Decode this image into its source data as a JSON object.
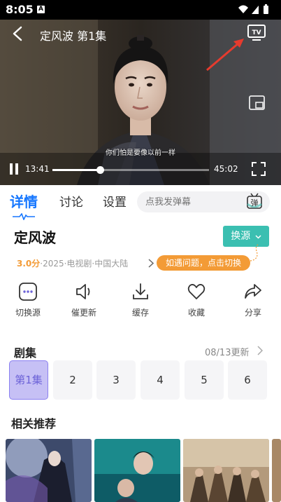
{
  "status_bar": {
    "time": "8:05",
    "notification_letter": "A"
  },
  "player": {
    "title": "定风波 第1集",
    "subtitle": "你们怕是要像以前一样",
    "current_time": "13:41",
    "total_time": "45:02",
    "progress": 0.304
  },
  "tabs": [
    {
      "label": "详情",
      "active": true
    },
    {
      "label": "讨论",
      "active": false
    },
    {
      "label": "设置",
      "active": false
    }
  ],
  "danmaku": {
    "placeholder": "点我发弹幕",
    "button_label": "弹"
  },
  "show": {
    "title": "定风波",
    "rating": "3.0分",
    "meta": "·2025·电视剧·中国大陆",
    "switch_source_label": "换源",
    "hint": "如遇问题，点击切换"
  },
  "actions": [
    {
      "label": "切换源",
      "icon": "source-icon"
    },
    {
      "label": "催更新",
      "icon": "megaphone-icon"
    },
    {
      "label": "缓存",
      "icon": "download-icon"
    },
    {
      "label": "收藏",
      "icon": "heart-icon"
    },
    {
      "label": "分享",
      "icon": "share-icon"
    }
  ],
  "episodes": {
    "title": "剧集",
    "update_text": "08/13更新",
    "items": [
      {
        "label": "第1集",
        "active": true
      },
      {
        "label": "2",
        "active": false
      },
      {
        "label": "3",
        "active": false
      },
      {
        "label": "4",
        "active": false
      },
      {
        "label": "5",
        "active": false
      },
      {
        "label": "6",
        "active": false
      }
    ]
  },
  "related": {
    "title": "相关推荐"
  },
  "colors": {
    "accent": "#1677ff",
    "source_button": "#3bbfb1",
    "rating": "#f39b36",
    "episode_active": "#c6c0f5",
    "arrow": "#e63b2e"
  }
}
